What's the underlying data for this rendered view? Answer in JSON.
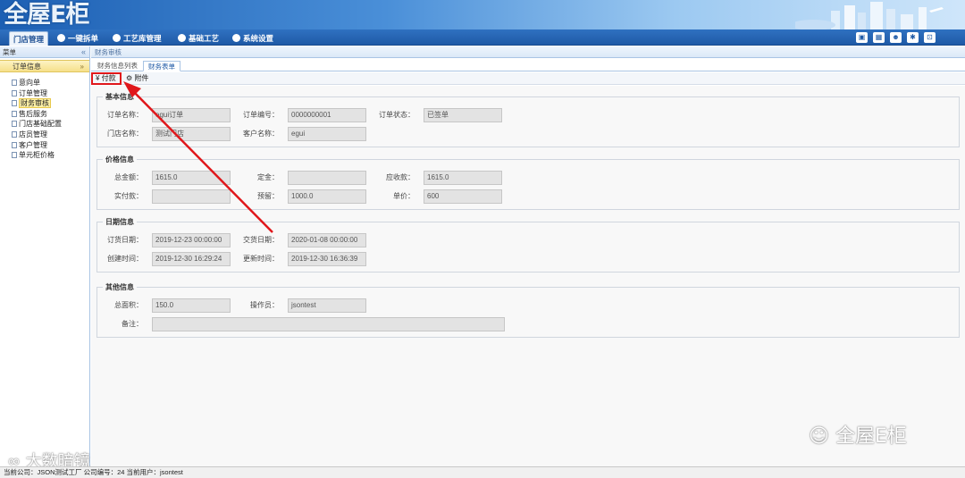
{
  "app": {
    "logo_text": "全屋E柜"
  },
  "menu": {
    "tabs": [
      "门店管理",
      "一键拆单",
      "工艺库管理",
      "基础工艺",
      "系统设置"
    ]
  },
  "toolbar_icons": [
    "screen-icon",
    "calendar-icon",
    "user-icon",
    "gear-icon",
    "logout-icon"
  ],
  "sidebar": {
    "header": "菜单",
    "collapse_icon": "«",
    "group": "订单信息",
    "group_icon": "»",
    "items": [
      {
        "label": "意向单"
      },
      {
        "label": "订单管理"
      },
      {
        "label": "财务审核",
        "selected": true
      },
      {
        "label": "售后服务"
      },
      {
        "label": "门店基础配置"
      },
      {
        "label": "店员管理"
      },
      {
        "label": "客户管理"
      },
      {
        "label": "单元柜价格"
      }
    ]
  },
  "breadcrumb": "财务审核",
  "tabs": [
    "财务信息列表",
    "财务表单"
  ],
  "actions": {
    "pay": "¥ 付款",
    "attach": "附件"
  },
  "sections": {
    "basic": {
      "title": "基本信息",
      "order_name_label": "订单名称：",
      "order_name": "egui订单",
      "order_no_label": "订单编号：",
      "order_no": "0000000001",
      "order_status_label": "订单状态：",
      "order_status": "已签单",
      "store_label": "门店名称：",
      "store": "测试门店",
      "customer_label": "客户名称：",
      "customer": "egui"
    },
    "price": {
      "title": "价格信息",
      "total_label": "总金额：",
      "total": "1615.0",
      "deposit_label": "定金：",
      "deposit": "",
      "receivable_label": "应收款：",
      "receivable": "1615.0",
      "paid_label": "实付款：",
      "paid": "",
      "prepay_label": "预留：",
      "prepay": "1000.0",
      "unit_label": "单价：",
      "unit": "600"
    },
    "date": {
      "title": "日期信息",
      "order_date_label": "订货日期：",
      "order_date": "2019-12-23 00:00:00",
      "delivery_label": "交货日期：",
      "delivery": "2020-01-08 00:00:00",
      "created_label": "创建时间：",
      "created": "2019-12-30 16:29:24",
      "updated_label": "更新时间：",
      "updated": "2019-12-30 16:36:39"
    },
    "other": {
      "title": "其他信息",
      "area_label": "总面积：",
      "area": "150.0",
      "operator_label": "操作员：",
      "operator": "jsontest",
      "remark_label": "备注：",
      "remark": ""
    }
  },
  "statusbar": "当前公司：JSON测试工厂   公司编号：24   当前用户：jsontest",
  "watermarks": {
    "left": "大数暗镜",
    "right": "全屋E柜"
  },
  "accent": "#1f5aa6",
  "highlight": "#e0171b"
}
